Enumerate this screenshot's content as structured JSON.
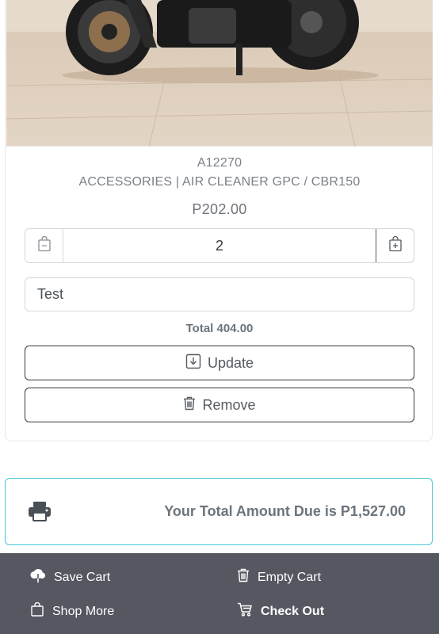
{
  "product": {
    "sku": "A12270",
    "name": "ACCESSORIES | AIR CLEANER GPC / CBR150",
    "price": "P202.00",
    "quantity": "2",
    "note_value": "Test",
    "total": "Total 404.00"
  },
  "actions": {
    "update_label": "Update",
    "remove_label": "Remove"
  },
  "summary": {
    "amount_due": "Your Total Amount Due is P1,527.00"
  },
  "footer": {
    "save_cart": "Save Cart",
    "empty_cart": "Empty Cart",
    "shop_more": "Shop More",
    "check_out": "Check Out"
  },
  "icons": {
    "minus": "bag-minus-icon",
    "plus": "bag-plus-icon",
    "update": "download-box-icon",
    "remove": "trash-icon",
    "printer": "printer-icon",
    "save": "cloud-download-icon",
    "empty": "trash-icon",
    "shop": "shopping-bag-icon",
    "check": "cart-icon"
  },
  "colors": {
    "footer_bg": "#555861",
    "due_border": "#45c6d5"
  }
}
